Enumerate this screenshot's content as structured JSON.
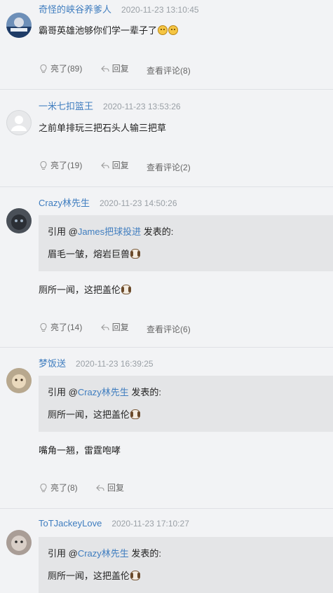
{
  "comments": [
    {
      "author": "奇怪的峡谷养爹人",
      "time": "2020-11-23 13:10:45",
      "text": "霸哥英雄池够你们学一辈子了",
      "emoji": "sad-face-emoji",
      "likes": "亮了(89)",
      "reply": "回复",
      "view": "查看评论(8)"
    },
    {
      "author": "一米七扣篮王",
      "time": "2020-11-23 13:53:26",
      "text": "之前单排玩三把石头人输三把草",
      "likes": "亮了(19)",
      "reply": "回复",
      "view": "查看评论(2)"
    },
    {
      "author": "Crazy林先生",
      "time": "2020-11-23 14:50:26",
      "quote": {
        "prefix": "引用 @",
        "author": "James把球投进",
        "suffix": " 发表的:",
        "text": "眉毛一皱，熔岩巨兽"
      },
      "text": "厕所一闻，这把盖伦",
      "likes": "亮了(14)",
      "reply": "回复",
      "view": "查看评论(6)"
    },
    {
      "author": "梦饭送",
      "time": "2020-11-23 16:39:25",
      "quote": {
        "prefix": "引用 @",
        "author": "Crazy林先生",
        "suffix": " 发表的:",
        "text": "厕所一闻，这把盖伦"
      },
      "text": "嘴角一翘，雷霆咆哮",
      "likes": "亮了(8)",
      "reply": "回复"
    },
    {
      "author": "ToTJackeyLove",
      "time": "2020-11-23 17:10:27",
      "quote": {
        "prefix": "引用 @",
        "author": "Crazy林先生",
        "suffix": " 发表的:",
        "text": "厕所一闻，这把盖伦"
      }
    }
  ]
}
